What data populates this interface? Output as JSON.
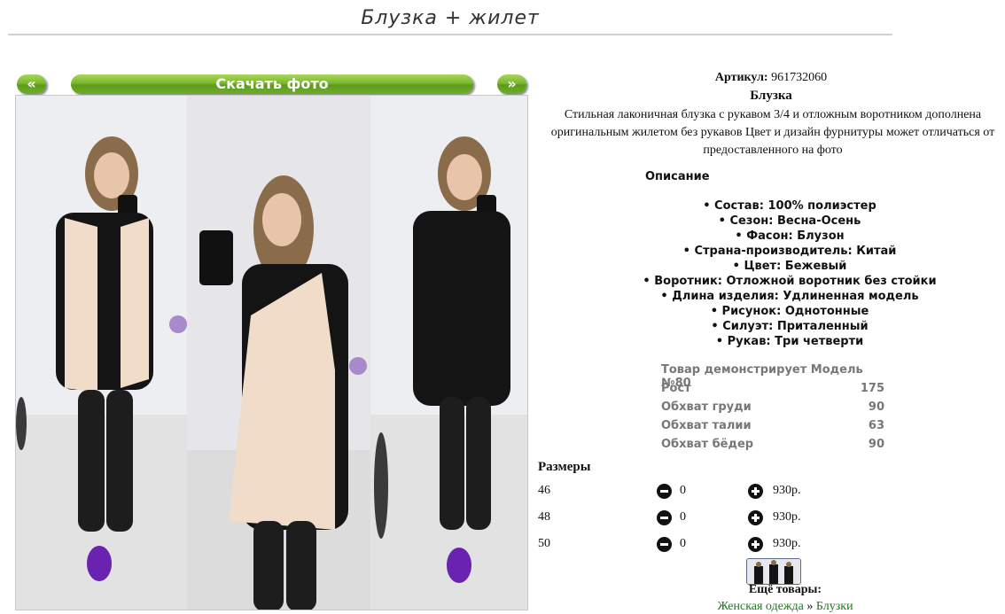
{
  "page": {
    "title": "Блузка + жилет"
  },
  "gallery": {
    "prev_label": "«",
    "download_label": "Скачать фото",
    "next_label": "»"
  },
  "product": {
    "article_label": "Артикул:",
    "article_value": "961732060",
    "name": "Блузка",
    "description": "Стильная лаконичная блузка с рукавом 3/4 и отложным воротником дополнена оригинальным жилетом без рукавов Цвет и дизайн фурнитуры может отличаться от предоставленного на фото",
    "description_heading": "Описание",
    "features": [
      "• Состав: 100% полиэстер",
      "• Сезон: Весна-Осень",
      "• Фасон: Блузон",
      "• Страна-производитель: Китай",
      "• Цвет: Бежевый",
      "• Воротник: Отложной воротник без стойки",
      "• Длина изделия: Удлиненная модель",
      "• Рисунок: Однотонные",
      "• Силуэт: Приталенный",
      "• Рукав: Три четверти"
    ]
  },
  "model": {
    "heading": "Товар демонстрирует Модель №80",
    "rows": [
      {
        "label": "Рост",
        "value": "175"
      },
      {
        "label": "Обхват груди",
        "value": "90"
      },
      {
        "label": "Обхват талии",
        "value": "63"
      },
      {
        "label": "Обхват бёдер",
        "value": "90"
      }
    ]
  },
  "sizes": {
    "heading": "Размеры",
    "rows": [
      {
        "size": "46",
        "qty": "0",
        "price": "930р."
      },
      {
        "size": "48",
        "qty": "0",
        "price": "930р."
      },
      {
        "size": "50",
        "qty": "0",
        "price": "930р."
      }
    ]
  },
  "more": {
    "heading": "Ещё товары:",
    "crumb1": "Женская одежда",
    "separator": "»",
    "crumb2": "Блузки"
  },
  "colors": {
    "accent_green": "#6fae2a",
    "link_green": "#1a7a1a"
  }
}
